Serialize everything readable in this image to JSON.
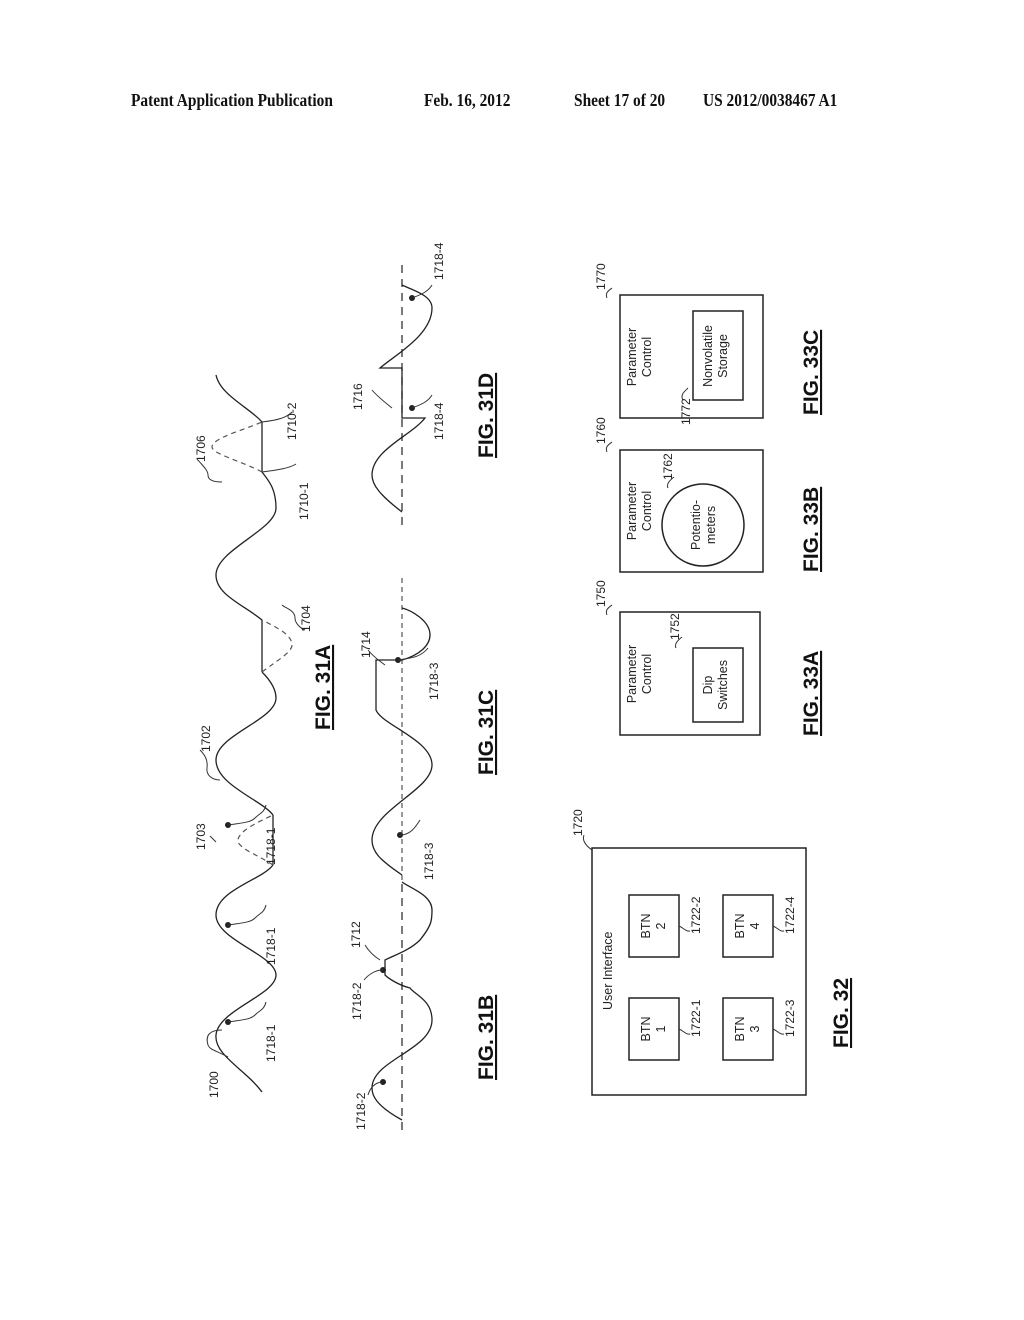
{
  "header": {
    "publication": "Patent Application Publication",
    "date": "Feb. 16, 2012",
    "sheet": "Sheet 17 of 20",
    "number": "US 2012/0038467 A1"
  },
  "figures": {
    "fig31a": {
      "label": "FIG. 31A",
      "refs": {
        "waveform": "1700",
        "marker_a": "1718-1",
        "marker_b": "1718-1",
        "marker_c": "1718-1",
        "clipped_region": "1702",
        "dashed_peak": "1703",
        "clipped_trough": "1704",
        "repeat_region": "1706",
        "edge_1": "1710-1",
        "edge_2": "1710-2"
      }
    },
    "fig31b": {
      "label": "FIG. 31B",
      "refs": {
        "marker_a": "1718-2",
        "marker_b": "1718-2",
        "flat_top": "1712"
      }
    },
    "fig31c": {
      "label": "FIG. 31C",
      "refs": {
        "marker_a": "1718-3",
        "marker_b": "1718-3",
        "step": "1714"
      }
    },
    "fig31d": {
      "label": "FIG. 31D",
      "refs": {
        "gap": "1716",
        "marker_a": "1718-4",
        "marker_b": "1718-4"
      }
    },
    "fig32": {
      "label": "FIG. 32",
      "ref": "1720",
      "title": "User Interface",
      "buttons": [
        {
          "line1": "BTN",
          "line2": "1",
          "ref": "1722-1"
        },
        {
          "line1": "BTN",
          "line2": "2",
          "ref": "1722-2"
        },
        {
          "line1": "BTN",
          "line2": "3",
          "ref": "1722-3"
        },
        {
          "line1": "BTN",
          "line2": "4",
          "ref": "1722-4"
        }
      ]
    },
    "fig33a": {
      "label": "FIG. 33A",
      "ref": "1750",
      "title_line1": "Parameter",
      "title_line2": "Control",
      "inner_ref": "1752",
      "inner_line1": "Dip",
      "inner_line2": "Switches"
    },
    "fig33b": {
      "label": "FIG. 33B",
      "ref": "1760",
      "title_line1": "Parameter",
      "title_line2": "Control",
      "inner_ref": "1762",
      "inner_line1": "Potentio-",
      "inner_line2": "meters"
    },
    "fig33c": {
      "label": "FIG. 33C",
      "ref": "1770",
      "title_line1": "Parameter",
      "title_line2": "Control",
      "inner_ref": "1772",
      "inner_line1": "Nonvolatile",
      "inner_line2": "Storage"
    }
  }
}
